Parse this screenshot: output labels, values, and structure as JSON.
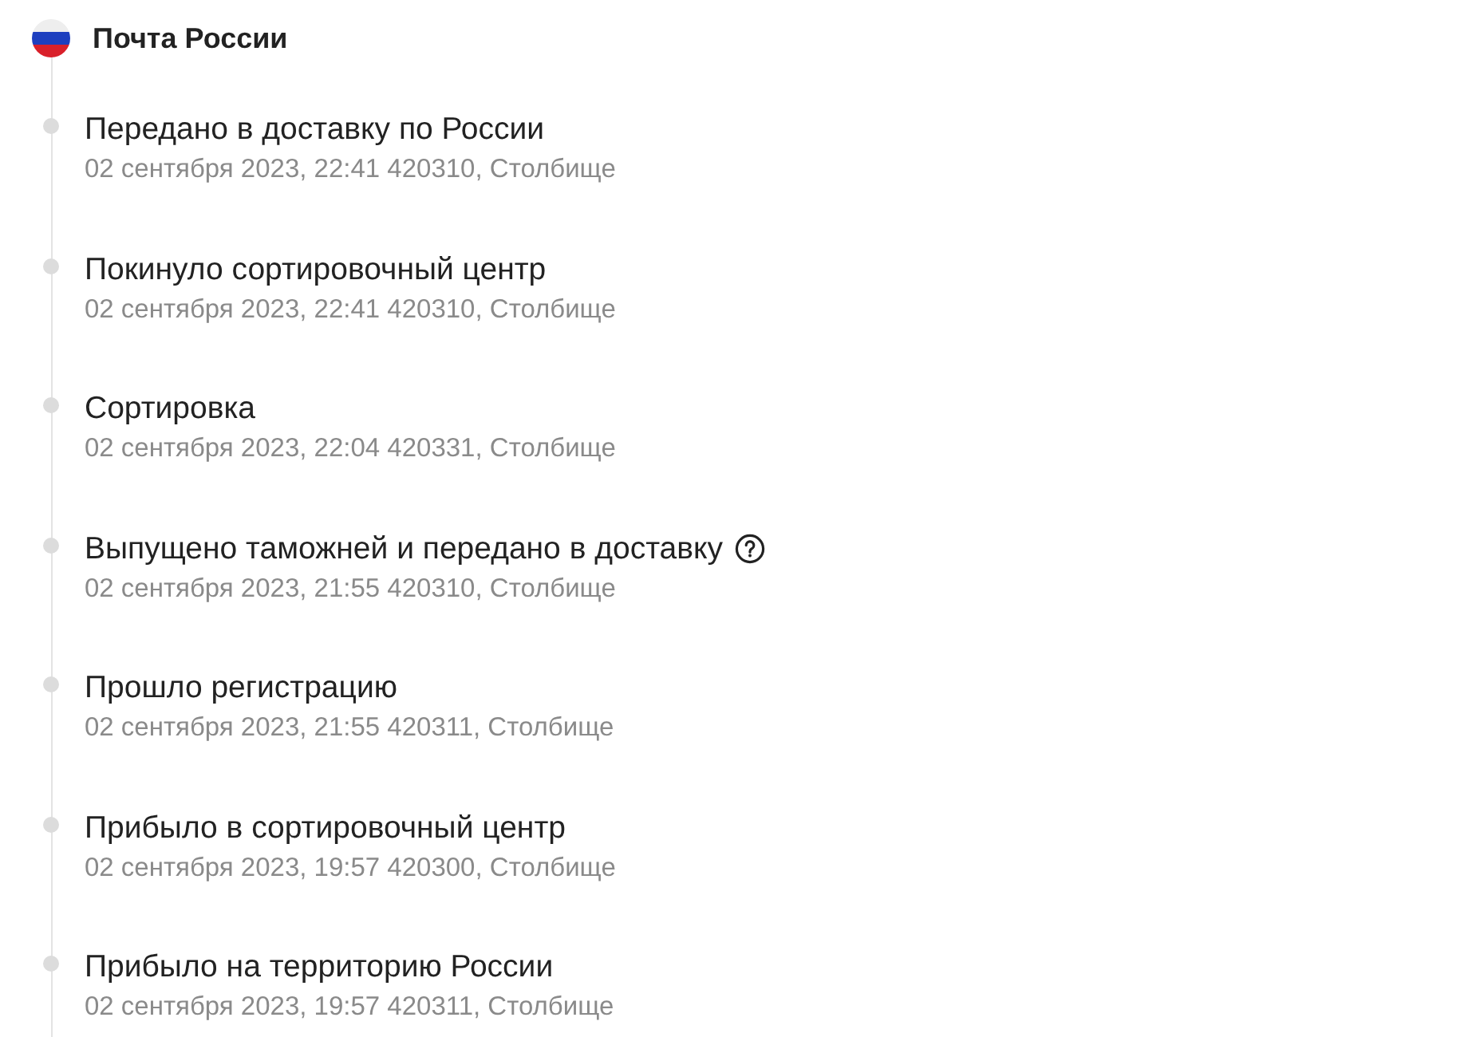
{
  "carrier": {
    "name": "Почта России"
  },
  "events": [
    {
      "title": "Передано в доставку по России",
      "details": "02 сентября 2023, 22:41 420310, Столбище",
      "help": false
    },
    {
      "title": "Покинуло сортировочный центр",
      "details": "02 сентября 2023, 22:41 420310, Столбище",
      "help": false
    },
    {
      "title": "Сортировка",
      "details": "02 сентября 2023, 22:04 420331, Столбище",
      "help": false
    },
    {
      "title": "Выпущено таможней и передано в доставку",
      "details": "02 сентября 2023, 21:55 420310, Столбище",
      "help": true
    },
    {
      "title": "Прошло регистрацию",
      "details": "02 сентября 2023, 21:55 420311, Столбище",
      "help": false
    },
    {
      "title": "Прибыло в сортировочный центр",
      "details": "02 сентября 2023, 19:57 420300, Столбище",
      "help": false
    },
    {
      "title": "Прибыло на территорию России",
      "details": "02 сентября 2023, 19:57 420311, Столбище",
      "help": false
    }
  ]
}
